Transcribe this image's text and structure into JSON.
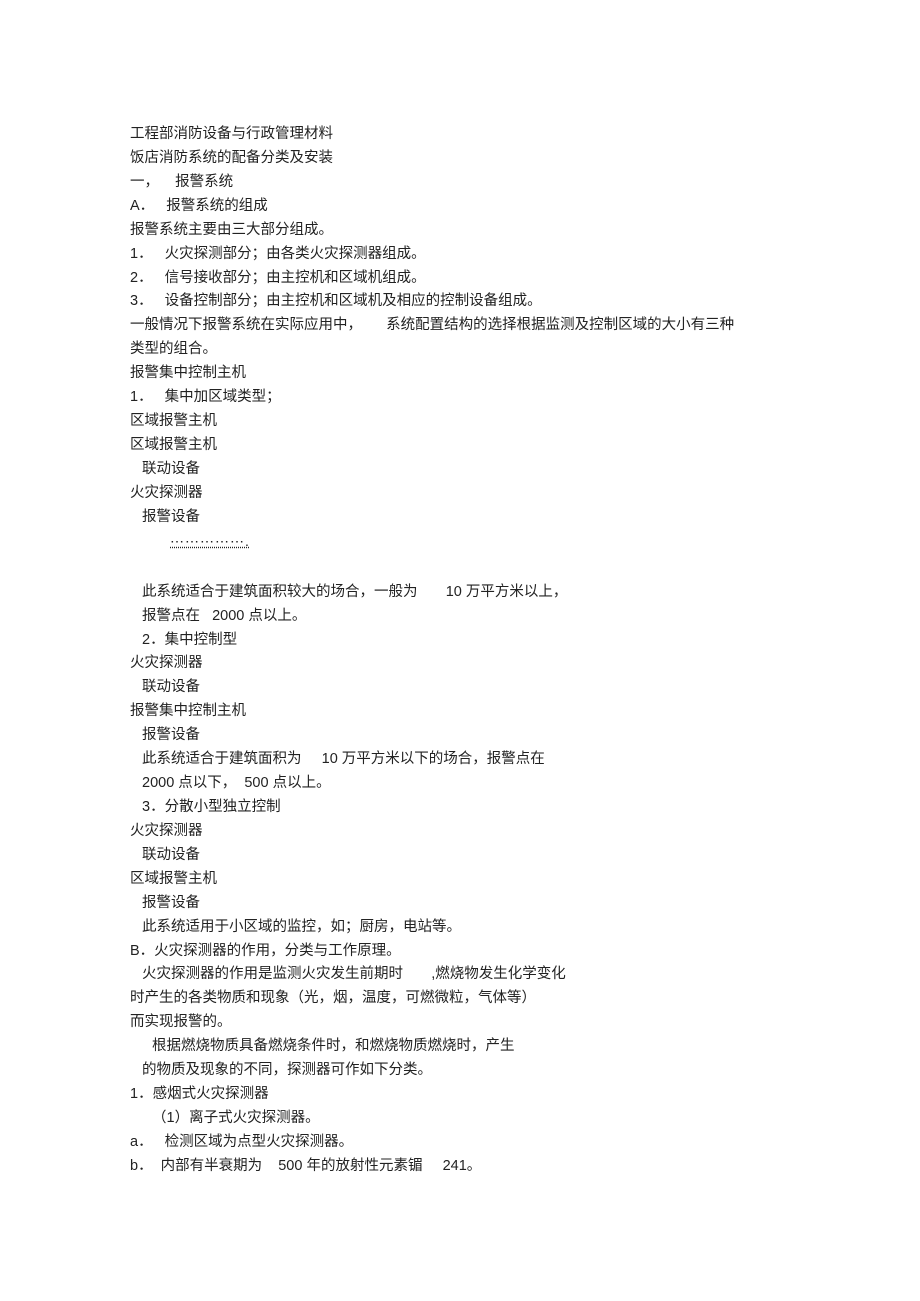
{
  "lines": [
    {
      "cls": "indent-0",
      "t": "工程部消防设备与行政管理材料"
    },
    {
      "cls": "indent-0",
      "t": "饭店消防系统的配备分类及安装"
    },
    {
      "cls": "indent-0",
      "t": "一，    报警系统"
    },
    {
      "cls": "indent-0",
      "t": "A．   报警系统的组成"
    },
    {
      "cls": "indent-0",
      "t": "报警系统主要由三大部分组成。"
    },
    {
      "cls": "indent-0",
      "t": "1．   火灾探测部分；由各类火灾探测器组成。"
    },
    {
      "cls": "indent-0",
      "t": "2．   信号接收部分；由主控机和区域机组成。"
    },
    {
      "cls": "indent-0",
      "t": "3．   设备控制部分；由主控机和区域机及相应的控制设备组成。"
    },
    {
      "cls": "indent-0",
      "t": "一般情况下报警系统在实际应用中，      系统配置结构的选择根据监测及控制区域的大小有三种"
    },
    {
      "cls": "indent-0",
      "t": "类型的组合。"
    },
    {
      "cls": "indent-0",
      "t": "报警集中控制主机"
    },
    {
      "cls": "indent-0",
      "t": "1．   集中加区域类型；"
    },
    {
      "cls": "indent-0",
      "t": "区域报警主机"
    },
    {
      "cls": "indent-0",
      "t": "区域报警主机"
    },
    {
      "cls": "indent-1",
      "t": "联动设备"
    },
    {
      "cls": "indent-0",
      "t": "火灾探测器"
    },
    {
      "cls": "indent-1",
      "t": "报警设备"
    },
    {
      "cls": "dotted",
      "t": "⋯⋯⋯⋯⋯."
    },
    {
      "cls": "indent-0",
      "t": " "
    },
    {
      "cls": "indent-1",
      "t": "此系统适合于建筑面积较大的场合，一般为       10 万平方米以上，"
    },
    {
      "cls": "indent-1",
      "t": "报警点在   2000 点以上。"
    },
    {
      "cls": "indent-1",
      "t": "2．集中控制型"
    },
    {
      "cls": "indent-0",
      "t": "火灾探测器"
    },
    {
      "cls": "indent-1",
      "t": "联动设备"
    },
    {
      "cls": "indent-0",
      "t": "报警集中控制主机"
    },
    {
      "cls": "indent-1",
      "t": "报警设备"
    },
    {
      "cls": "indent-1",
      "t": "此系统适合于建筑面积为     10 万平方米以下的场合，报警点在"
    },
    {
      "cls": "indent-1",
      "t": "2000 点以下，  500 点以上。"
    },
    {
      "cls": "indent-1",
      "t": "3．分散小型独立控制"
    },
    {
      "cls": "indent-0",
      "t": "火灾探测器"
    },
    {
      "cls": "indent-1",
      "t": "联动设备"
    },
    {
      "cls": "indent-0",
      "t": "区域报警主机"
    },
    {
      "cls": "indent-1",
      "t": "报警设备"
    },
    {
      "cls": "indent-1",
      "t": "此系统适用于小区域的监控，如；厨房，电站等。"
    },
    {
      "cls": "indent-0",
      "t": "B．火灾探测器的作用，分类与工作原理。"
    },
    {
      "cls": "indent-1",
      "t": "火灾探测器的作用是监测火灾发生前期时       ,燃烧物发生化学变化"
    },
    {
      "cls": "indent-0",
      "t": "时产生的各类物质和现象（光，烟，温度，可燃微粒，气体等）"
    },
    {
      "cls": "indent-0",
      "t": "而实现报警的。"
    },
    {
      "cls": "indent-2",
      "t": "根据燃烧物质具备燃烧条件时，和燃烧物质燃烧时，产生"
    },
    {
      "cls": "indent-1",
      "t": "的物质及现象的不同，探测器可作如下分类。"
    },
    {
      "cls": "indent-0",
      "t": "1．感烟式火灾探测器"
    },
    {
      "cls": "indent-2",
      "t": "（1）离子式火灾探测器。"
    },
    {
      "cls": "indent-0",
      "t": "a．   检测区域为点型火灾探测器。"
    },
    {
      "cls": "indent-0",
      "t": "b．  内部有半衰期为    500 年的放射性元素镅     241。"
    }
  ]
}
